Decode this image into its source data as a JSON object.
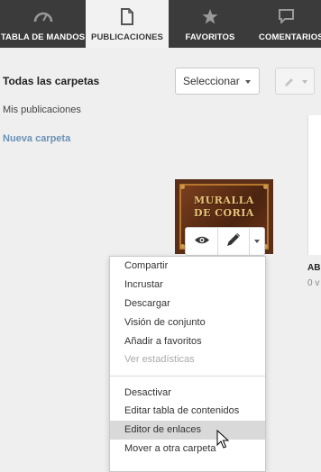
{
  "nav": {
    "tabs": [
      {
        "label": "TABLA DE MANDOS",
        "icon": "speedometer-icon",
        "active": false
      },
      {
        "label": "PUBLICACIONES",
        "icon": "document-icon",
        "active": true
      },
      {
        "label": "FAVORITOS",
        "icon": "star-icon",
        "active": false
      },
      {
        "label": "COMENTARIOS",
        "icon": "comment-icon",
        "active": false
      }
    ]
  },
  "sidebar": {
    "all_folders": "Todas las carpetas",
    "my_publications": "Mis publicaciones",
    "new_folder": "Nueva carpeta"
  },
  "toolbar": {
    "select_label": "Seleccionar"
  },
  "publication": {
    "cover_line1": "MURALLA",
    "cover_line2": "DE CORIA"
  },
  "second_card": {
    "title": "AB",
    "subtitle": "0 v"
  },
  "menu": {
    "items": [
      {
        "label": "Compartir",
        "disabled": false
      },
      {
        "label": "Incrustar",
        "disabled": false
      },
      {
        "label": "Descargar",
        "disabled": false
      },
      {
        "label": "Visión de conjunto",
        "disabled": false
      },
      {
        "label": "Añadir a favoritos",
        "disabled": false
      },
      {
        "label": "Ver estadísticas",
        "disabled": true
      },
      {
        "label": "Desactivar",
        "disabled": false
      },
      {
        "label": "Editar tabla de contenidos",
        "disabled": false
      },
      {
        "label": "Editor de enlaces",
        "disabled": false,
        "hovered": true
      },
      {
        "label": "Mover a otra carpeta",
        "disabled": false
      }
    ]
  },
  "colors": {
    "nav_bg": "#3b3b3b",
    "link_blue": "#6a92b5",
    "page_bg": "#efefef"
  }
}
